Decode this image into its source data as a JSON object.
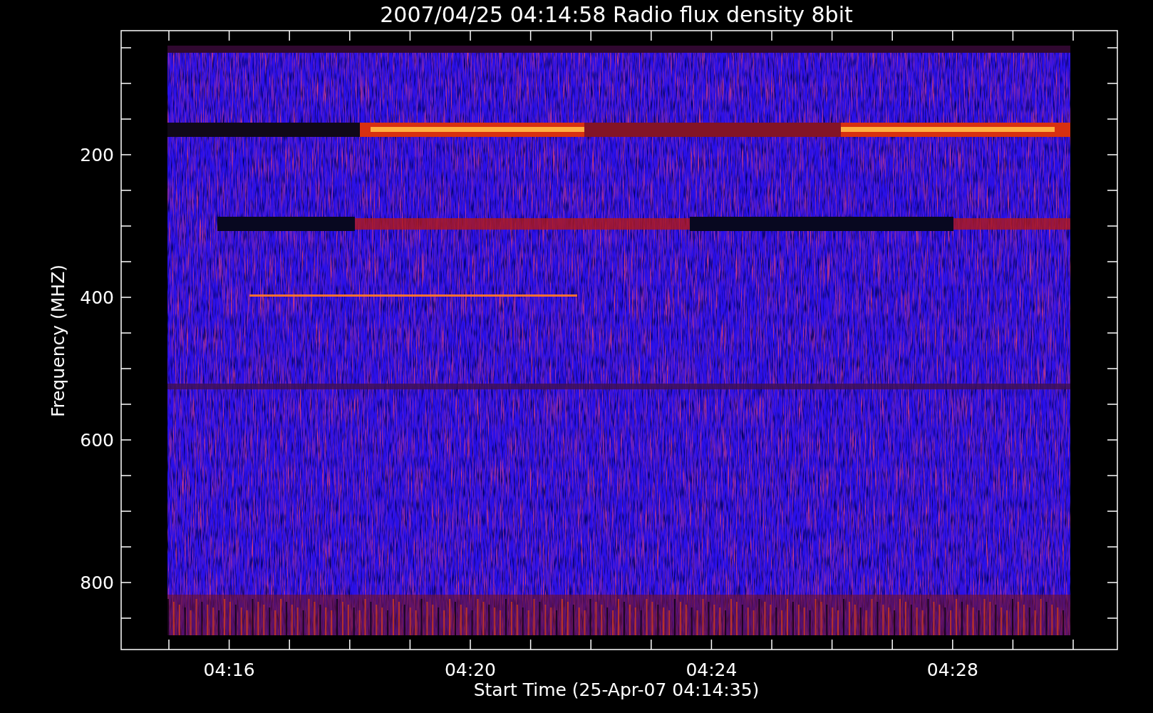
{
  "title": "2007/04/25 04:14:58 Radio flux density 8bit",
  "ylabel": "Frequency (MHZ)",
  "xlabel": "Start Time (25-Apr-07 04:14:35)",
  "yticks": [
    "200",
    "400",
    "600",
    "800"
  ],
  "xticks": [
    "04:16",
    "04:20",
    "04:24",
    "04:28"
  ]
}
